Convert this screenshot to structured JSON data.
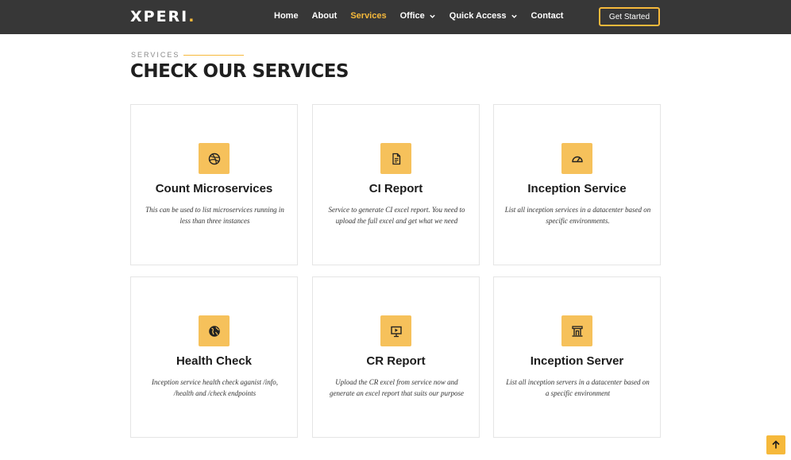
{
  "header": {
    "logo_text": "XPERI",
    "logo_dot": ".",
    "nav": {
      "home": "Home",
      "about": "About",
      "services": "Services",
      "office": "Office",
      "quick_access": "Quick Access",
      "contact": "Contact"
    },
    "cta_label": "Get Started"
  },
  "section": {
    "eyebrow": "SERVICES",
    "title": "CHECK OUR SERVICES"
  },
  "cards": [
    {
      "icon": "dribbble-icon",
      "title": "Count Microservices",
      "description": "This can be used to list microservices running in less than three instances"
    },
    {
      "icon": "file-text-icon",
      "title": "CI Report",
      "description": "Service to generate CI excel report. You need to upload the full excel and get what we need"
    },
    {
      "icon": "speedometer-icon",
      "title": "Inception Service",
      "description": "List all inception services in a datacenter based on specific environments."
    },
    {
      "icon": "globe-icon",
      "title": "Health Check",
      "description": "Inception service health check aganist /info, /health and /check endpoints"
    },
    {
      "icon": "easel-icon",
      "title": "CR Report",
      "description": "Upload the CR excel from service now and generate an excel report that suits our purpose"
    },
    {
      "icon": "bank-icon",
      "title": "Inception Server",
      "description": "List all inception servers in a datacenter based on a specific environment"
    }
  ],
  "colors": {
    "accent": "#f6b93b",
    "header_bg": "#373737",
    "icon_bg": "#f6c15b"
  }
}
